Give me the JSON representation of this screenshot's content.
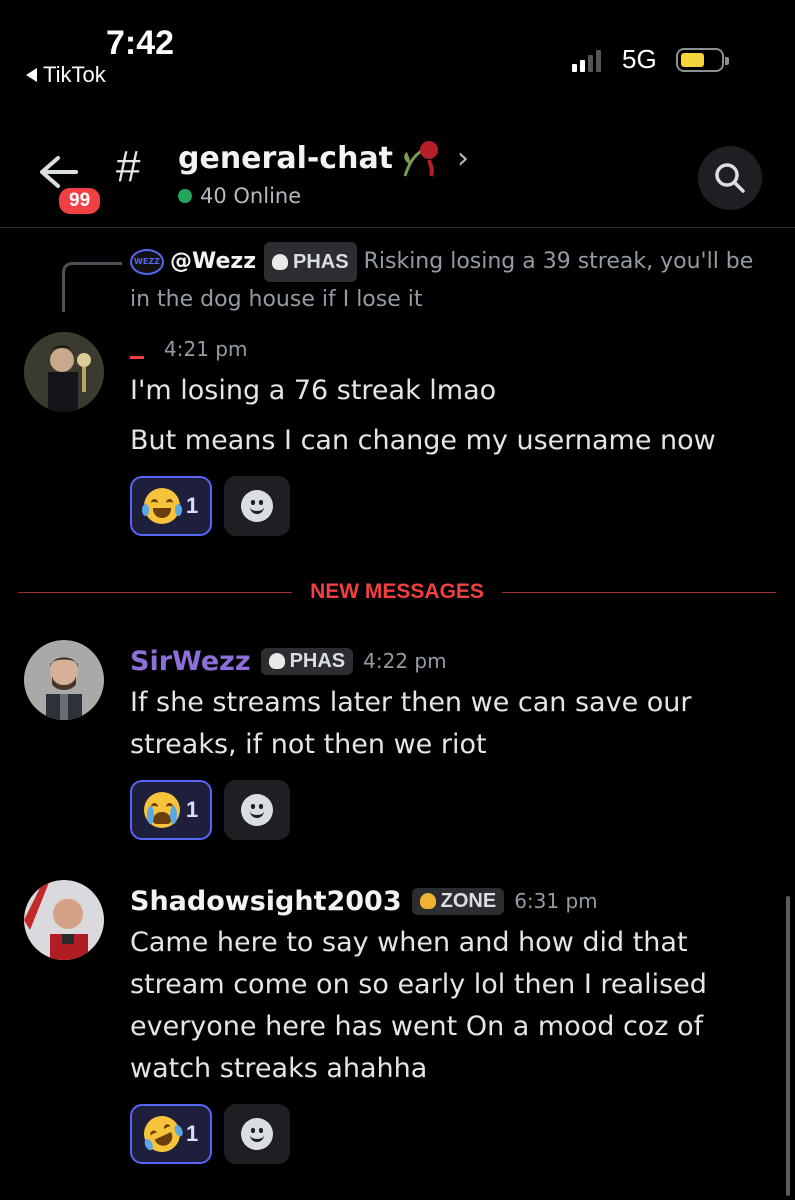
{
  "status_bar": {
    "time": "7:42",
    "back_app": "TikTok",
    "network": "5G",
    "battery_level": 0.6
  },
  "header": {
    "badge_count": "99",
    "channel_name": "general-chat",
    "online": "40 Online"
  },
  "reply": {
    "avatar_text": "WEZZ",
    "username": "@Wezz",
    "tag": "PHAS",
    "text": "Risking losing a 39 streak, you'll be in the dog house if I lose it"
  },
  "messages": [
    {
      "username": "",
      "time": "4:21 pm",
      "lines": [
        "I'm losing a 76 streak lmao",
        "But means I can change my username now"
      ],
      "reaction": {
        "emoji": "joy-emoji",
        "count": "1"
      }
    },
    {
      "username": "SirWezz",
      "tag": "PHAS",
      "time": "4:22 pm",
      "lines": [
        "If she streams later then we can save our streaks, if not then we riot"
      ],
      "reaction": {
        "emoji": "sob-emoji",
        "count": "1"
      }
    },
    {
      "username": "Shadowsight2003",
      "tag": "ZONE",
      "time": "6:31 pm",
      "lines": [
        "Came here to say when and how did that stream come on so early lol then I realised everyone here has went On a mood coz of watch streaks ahahha"
      ],
      "reaction": {
        "emoji": "rofl-emoji",
        "count": "1"
      }
    }
  ],
  "divider": "NEW MESSAGES",
  "colors": {
    "accent": "#5865f2",
    "new_messages": "#f23f43",
    "online": "#23a55a",
    "username_purple": "#8e6ed8"
  }
}
